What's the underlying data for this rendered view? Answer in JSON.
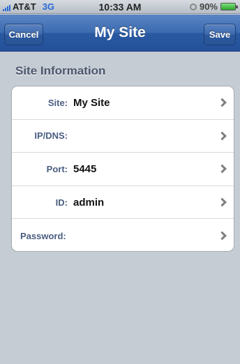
{
  "status_bar": {
    "carrier": "AT&T",
    "network": "3G",
    "time": "10:33 AM",
    "battery": "90%",
    "signal_bars": 4
  },
  "nav": {
    "title": "My Site",
    "cancel_label": "Cancel",
    "save_label": "Save"
  },
  "section": {
    "header": "Site Information",
    "rows": [
      {
        "label": "Site:",
        "value": "My Site"
      },
      {
        "label": "IP/DNS:",
        "value": ""
      },
      {
        "label": "Port:",
        "value": "5445"
      },
      {
        "label": "ID:",
        "value": "admin"
      },
      {
        "label": "Password:",
        "value": ""
      }
    ]
  },
  "colors": {
    "nav_bar": "#3b6bb0",
    "background": "#c5ccd4",
    "label": "#4a5d80"
  }
}
